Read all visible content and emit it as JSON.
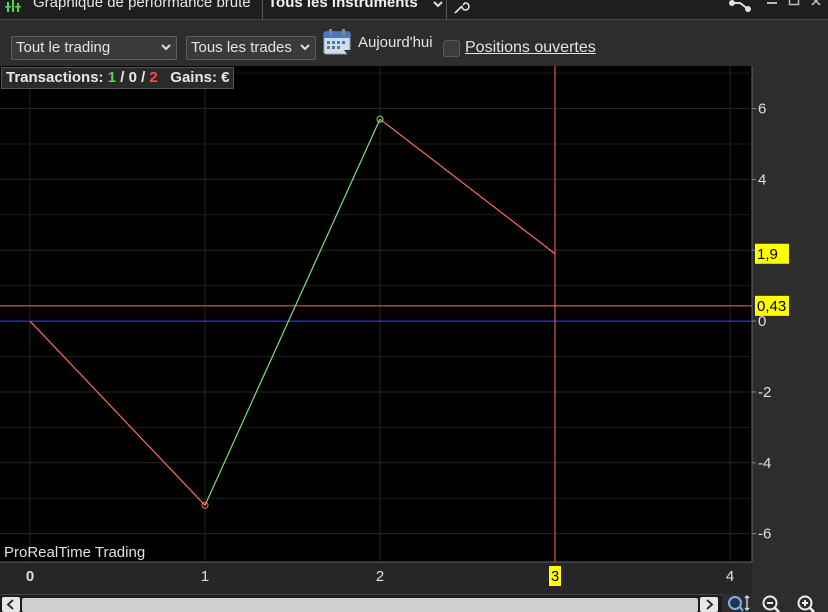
{
  "window": {
    "title": "Graphique de performance brute",
    "instrument_selector": "Tous les instruments"
  },
  "toolbar": {
    "scope_select": "Tout le trading",
    "trades_select": "Tous les trades",
    "date_label": "Aujourd'hui",
    "open_positions_label": "Positions ouvertes",
    "open_positions_checked": false
  },
  "stats": {
    "transactions_label": "Transactions:",
    "wins": "1",
    "neutral": "0",
    "losses": "2",
    "gains_label": "Gains:",
    "currency": "€"
  },
  "watermark": "ProRealTime Trading",
  "colors": {
    "background": "#000000",
    "gain_line": "#7ee07e",
    "loss_line": "#ff6a55",
    "zero_line": "#3a3aff",
    "average_line": "#ff6a55",
    "cursor_line": "#ff6a55",
    "label_bg": "#ffff00"
  },
  "chart_data": {
    "type": "line",
    "x": [
      0,
      1,
      2,
      3
    ],
    "y": [
      0,
      -5.2,
      5.7,
      1.9
    ],
    "xlim": [
      0,
      4.2
    ],
    "ylim": [
      -6.8,
      7.2
    ],
    "x_ticks": [
      "0",
      "1",
      "2",
      "3",
      "4"
    ],
    "y_ticks": [
      "6",
      "4",
      "2",
      "0",
      "-2",
      "-4",
      "-6"
    ],
    "y_tick_values": [
      6,
      4,
      2,
      0,
      -2,
      -4,
      -6
    ],
    "average_value": 0.43,
    "average_label": "0,43",
    "last_value_label": "1,9",
    "cursor_x": 3,
    "cursor_x_label": "3",
    "grid": true
  }
}
